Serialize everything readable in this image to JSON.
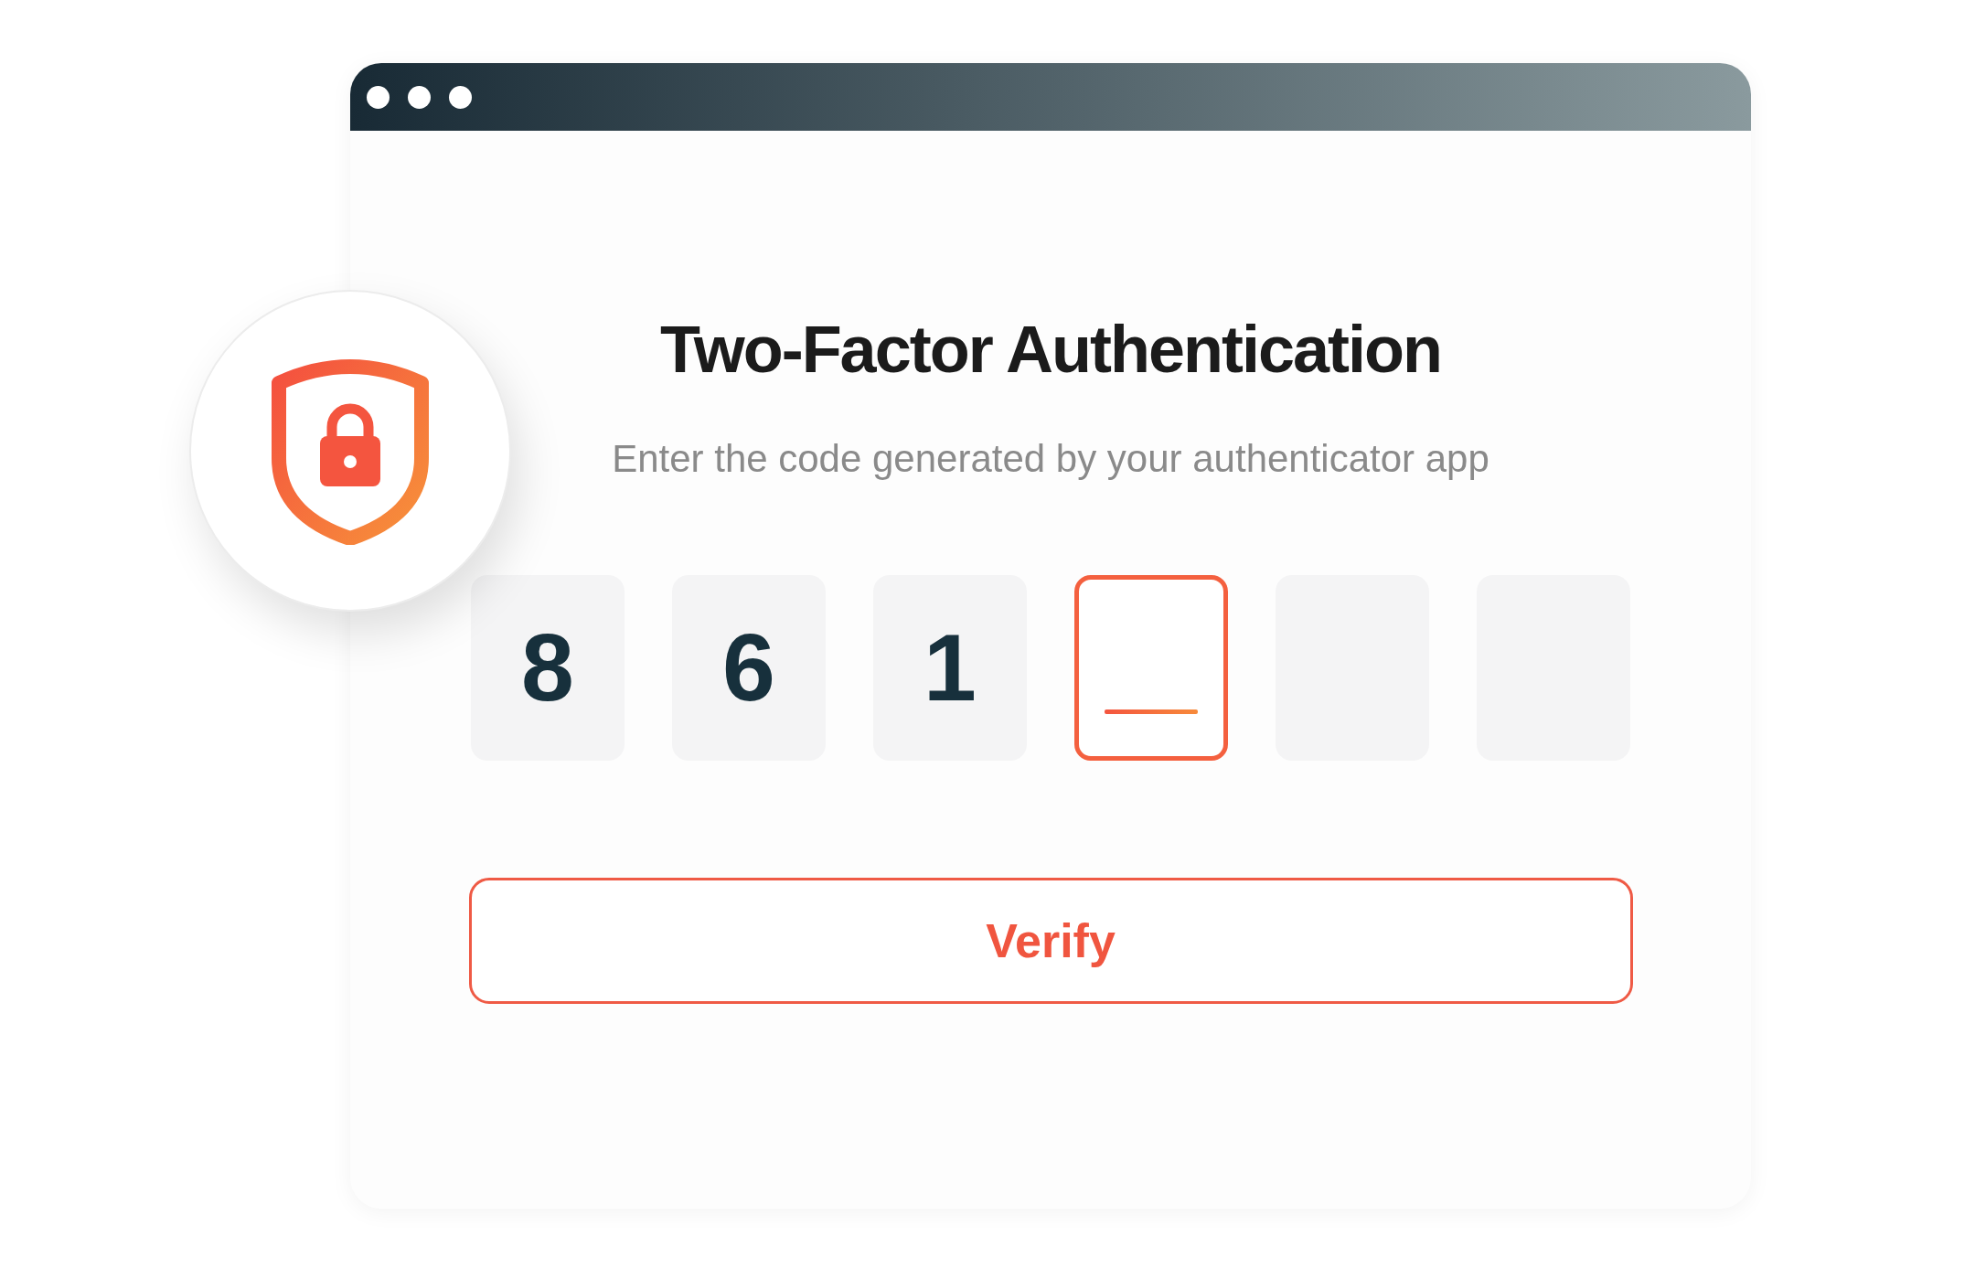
{
  "heading": "Two-Factor Authentication",
  "subtitle": "Enter the code generated by your authenticator app",
  "code_boxes": [
    {
      "digit": "8",
      "focused": false
    },
    {
      "digit": "6",
      "focused": false
    },
    {
      "digit": "1",
      "focused": false
    },
    {
      "focused": true
    },
    {
      "focused": false
    },
    {
      "focused": false
    }
  ],
  "verify_button": {
    "label": "Verify"
  }
}
